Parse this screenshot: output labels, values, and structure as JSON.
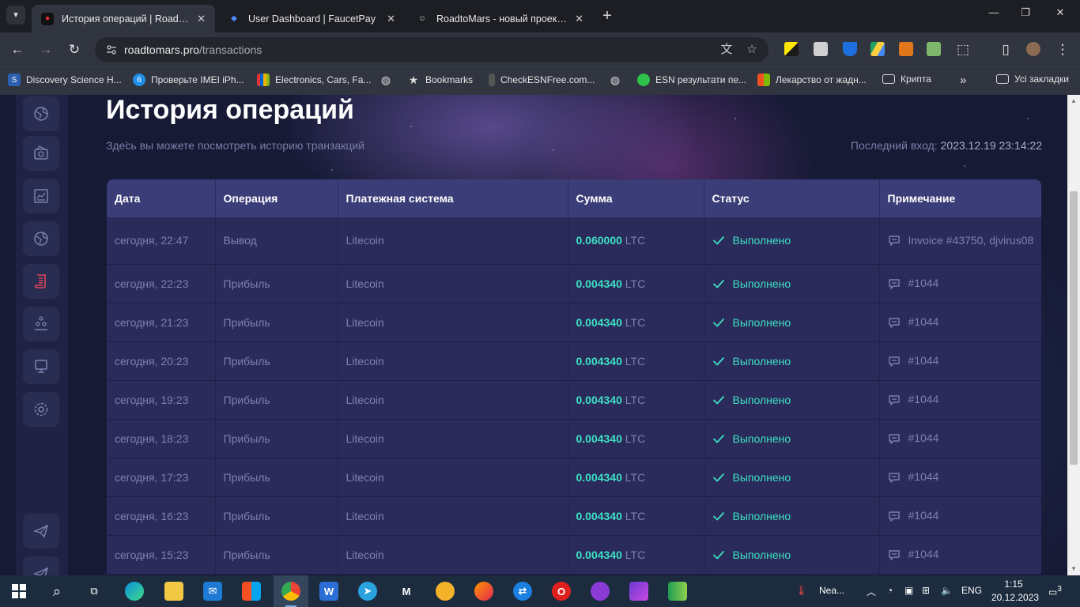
{
  "browser": {
    "tabs": [
      {
        "title": "История операций | RoadtoMars",
        "active": true
      },
      {
        "title": "User Dashboard | FaucetPay",
        "active": false
      },
      {
        "title": "RoadtoMars - новый проект по",
        "active": false
      }
    ],
    "new_tab": "+",
    "url_host": "roadtomars.pro",
    "url_path": "/transactions",
    "bookmarks": [
      "Discovery Science H...",
      "Проверьте IMEI iPh...",
      "Electronics, Cars, Fa...",
      "Bookmarks",
      "CheckESNFree.com...",
      "ESN результати пе...",
      "Лекарство от жадн...",
      "Крипта",
      "Усі закладки"
    ],
    "bookmarks_overflow": "»"
  },
  "page": {
    "title": "История операций",
    "subtitle": "Здесь вы можете посмотреть историю транзакций",
    "last_login_label": "Последний вход:",
    "last_login_value": "2023.12.19 23:14:22"
  },
  "table": {
    "headers": [
      "Дата",
      "Операция",
      "Платежная система",
      "Сумма",
      "Статус",
      "Примечание"
    ],
    "rows": [
      {
        "date": "сегодня, 22:47",
        "op": "Вывод",
        "system": "Litecoin",
        "amount": "0.060000",
        "currency": "LTC",
        "status": "Выполнено",
        "note": "Invoice #43750, djvirus08"
      },
      {
        "date": "сегодня, 22:23",
        "op": "Прибыль",
        "system": "Litecoin",
        "amount": "0.004340",
        "currency": "LTC",
        "status": "Выполнено",
        "note": "#1044"
      },
      {
        "date": "сегодня, 21:23",
        "op": "Прибыль",
        "system": "Litecoin",
        "amount": "0.004340",
        "currency": "LTC",
        "status": "Выполнено",
        "note": "#1044"
      },
      {
        "date": "сегодня, 20:23",
        "op": "Прибыль",
        "system": "Litecoin",
        "amount": "0.004340",
        "currency": "LTC",
        "status": "Выполнено",
        "note": "#1044"
      },
      {
        "date": "сегодня, 19:23",
        "op": "Прибыль",
        "system": "Litecoin",
        "amount": "0.004340",
        "currency": "LTC",
        "status": "Выполнено",
        "note": "#1044"
      },
      {
        "date": "сегодня, 18:23",
        "op": "Прибыль",
        "system": "Litecoin",
        "amount": "0.004340",
        "currency": "LTC",
        "status": "Выполнено",
        "note": "#1044"
      },
      {
        "date": "сегодня, 17:23",
        "op": "Прибыль",
        "system": "Litecoin",
        "amount": "0.004340",
        "currency": "LTC",
        "status": "Выполнено",
        "note": "#1044"
      },
      {
        "date": "сегодня, 16:23",
        "op": "Прибыль",
        "system": "Litecoin",
        "amount": "0.004340",
        "currency": "LTC",
        "status": "Выполнено",
        "note": "#1044"
      },
      {
        "date": "сегодня, 15:23",
        "op": "Прибыль",
        "system": "Litecoin",
        "amount": "0.004340",
        "currency": "LTC",
        "status": "Выполнено",
        "note": "#1044"
      }
    ]
  },
  "taskbar": {
    "weather": "Nea...",
    "lang": "ENG",
    "time": "1:15",
    "date": "20.12.2023",
    "notifications": "3"
  },
  "colors": {
    "accent": "#3fe0c4",
    "header_bg": "#3a3d78",
    "row_bg": "#2a2b5a",
    "muted_text": "#7d80ad"
  }
}
